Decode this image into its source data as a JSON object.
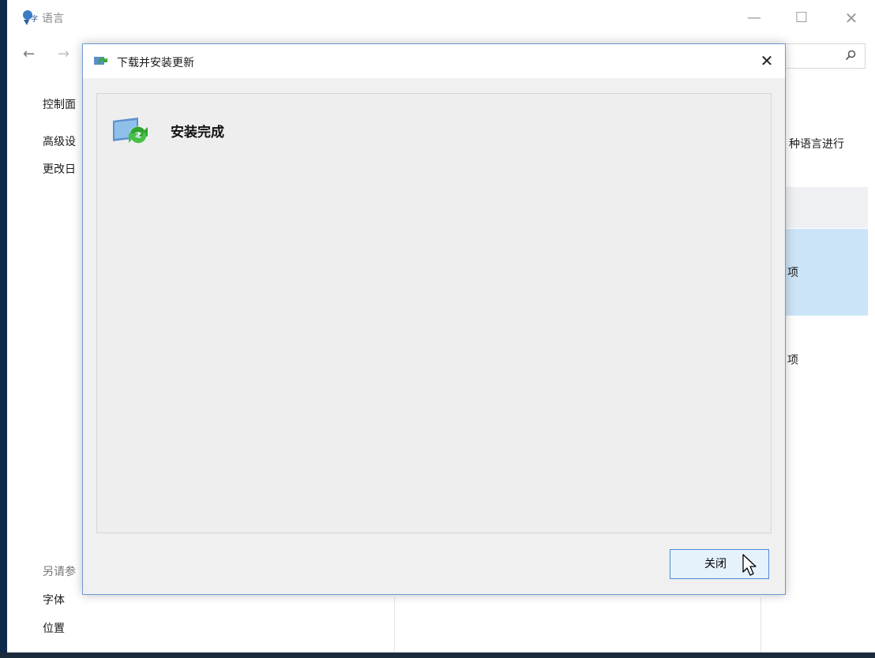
{
  "background_window": {
    "title": "语言",
    "controls": {
      "minimize": "—",
      "maximize": "☐",
      "close": "✕"
    },
    "nav": {
      "back": "←",
      "forward": "→"
    },
    "sidebar": {
      "links": [
        "控制面",
        "高级设",
        "更改日"
      ],
      "see_also_heading": "另请参",
      "see_also_links": [
        "字体",
        "位置"
      ]
    },
    "main_right_fragments": {
      "description": "种语言进行",
      "row1_option": "项",
      "row2_option": "项"
    }
  },
  "dialog": {
    "title": "下载并安装更新",
    "close_glyph": "✕",
    "status": "安装完成",
    "close_button_label": "关闭"
  },
  "colors": {
    "selection_row": "#cce4f7",
    "dialog_border": "#6d9bd1",
    "button_bg": "#e5f1fb",
    "button_border": "#4c8ad2"
  }
}
